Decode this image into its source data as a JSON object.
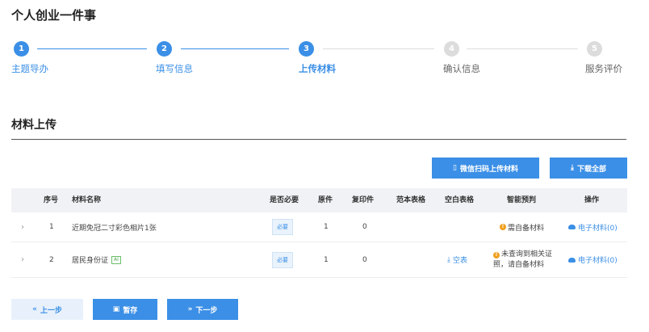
{
  "page": {
    "title": "个人创业一件事"
  },
  "steps": [
    {
      "number": "1",
      "label": "主题导办",
      "state": "done"
    },
    {
      "number": "2",
      "label": "填写信息",
      "state": "done"
    },
    {
      "number": "3",
      "label": "上传材料",
      "state": "active"
    },
    {
      "number": "4",
      "label": "确认信息",
      "state": "todo"
    },
    {
      "number": "5",
      "label": "服务评价",
      "state": "todo"
    }
  ],
  "section": {
    "title": "材料上传"
  },
  "toolbar": {
    "wechat_label": "微信扫码上传材料",
    "download_all_label": "下载全部"
  },
  "table": {
    "headers": {
      "index": "序号",
      "name": "材料名称",
      "required": "是否必要",
      "original": "原件",
      "copy": "复印件",
      "sample": "范本表格",
      "blank": "空白表格",
      "predict": "智能预判",
      "action": "操作"
    },
    "rows": [
      {
        "index": "1",
        "name": "近期免冠二寸彩色相片1张",
        "badge": "",
        "required": "必要",
        "original": "1",
        "copy": "0",
        "blank": "",
        "predict": "需自备材料",
        "action": "电子材料(0)"
      },
      {
        "index": "2",
        "name": "居民身份证",
        "badge": "AI",
        "required": "必要",
        "original": "1",
        "copy": "0",
        "blank": "空表",
        "predict": "未查询到相关证照，请自备材料",
        "action": "电子材料(0)"
      }
    ]
  },
  "footer": {
    "prev_label": "上一步",
    "save_label": "暂存",
    "next_label": "下一步"
  },
  "colors": {
    "primary": "#3b8fe6",
    "inactive": "#dcdcdc",
    "warning": "#f0a020"
  }
}
